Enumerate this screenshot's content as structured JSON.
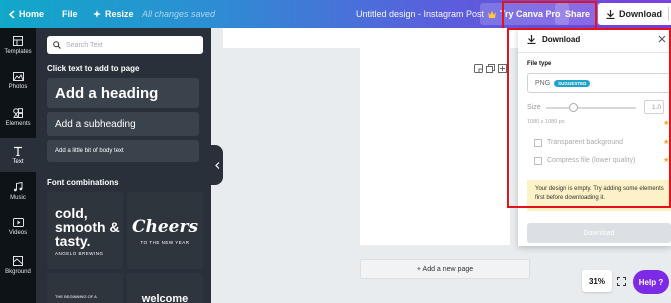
{
  "topbar": {
    "home": "Home",
    "file": "File",
    "resize": "Resize",
    "saved": "All changes saved",
    "design_title": "Untitled design - Instagram Post",
    "try_pro": "Try Canva Pro",
    "share": "Share",
    "download": "Download"
  },
  "rail": {
    "items": [
      {
        "label": "Templates",
        "icon": "templates-icon"
      },
      {
        "label": "Photos",
        "icon": "photos-icon"
      },
      {
        "label": "Elements",
        "icon": "elements-icon"
      },
      {
        "label": "Text",
        "icon": "text-icon"
      },
      {
        "label": "Music",
        "icon": "music-icon"
      },
      {
        "label": "Videos",
        "icon": "videos-icon"
      },
      {
        "label": "Bkground",
        "icon": "background-icon"
      }
    ]
  },
  "panel": {
    "search_placeholder": "Search Text",
    "add_title": "Click text to add to page",
    "heading": "Add a heading",
    "subheading": "Add a subheading",
    "body": "Add a little bit of body text",
    "font_combos_title": "Font combinations",
    "combos": [
      {
        "main": "cold, smooth & tasty.",
        "sub": "ANGELO BREWING"
      },
      {
        "main": "Cheers",
        "sub": "TO THE NEW YEAR"
      },
      {
        "main": "",
        "sub": "THE BEGINNING OF A"
      },
      {
        "main": "welcome",
        "sub": ""
      }
    ]
  },
  "canvas": {
    "add_page": "+ Add a new page",
    "zoom": "31%",
    "help": "Help ?"
  },
  "download_panel": {
    "title": "Download",
    "file_type_label": "File type",
    "file_type_value": "PNG",
    "suggested_badge": "SUGGESTED",
    "size_label": "Size",
    "size_value": "1.0",
    "size_slider_fraction": 0.3,
    "dimensions": "1080 x 1080 px",
    "transparent_bg": "Transparent background",
    "compress_file": "Compress file (lower quality)",
    "notice": "Your design is empty. Try adding some elements first before downloading it.",
    "download_button": "Download"
  },
  "colors": {
    "brand_purple": "#7d2ae8",
    "highlight_red": "#e6121b",
    "panel_dark": "#293039",
    "notice_yellow": "#fdf1c8"
  }
}
